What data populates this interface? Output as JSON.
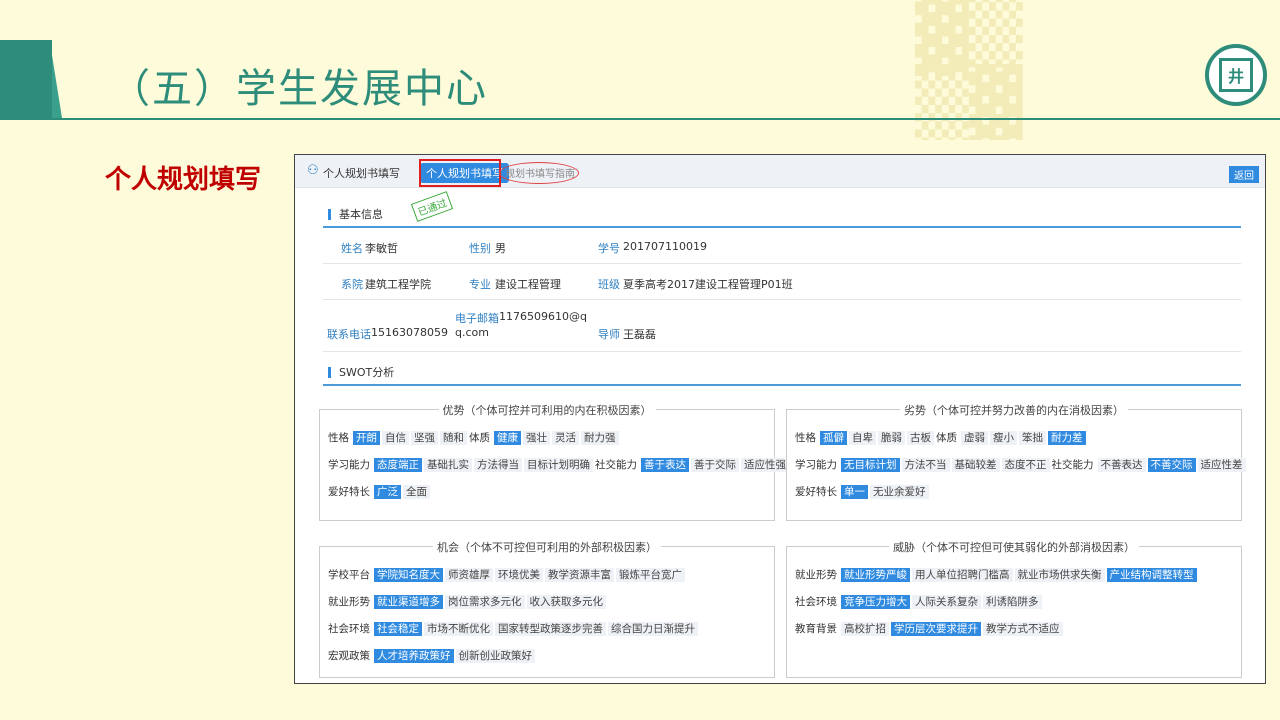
{
  "slide": {
    "title": "（五）学生发展中心",
    "side_label": "个人规划填写"
  },
  "topbar": {
    "title": "个人规划书填写",
    "active_tab": "个人规划书填写",
    "guide_link": "规划书填写指南",
    "back": "返回"
  },
  "basic": {
    "heading": "基本信息",
    "stamp": "已通过",
    "name_label": "姓名",
    "name": "李敏哲",
    "gender_label": "性别",
    "gender": "男",
    "id_label": "学号",
    "id": "201707110019",
    "dept_label": "系院",
    "dept": "建筑工程学院",
    "major_label": "专业",
    "major": "建设工程管理",
    "class_label": "班级",
    "class": "夏季高考2017建设工程管理P01班",
    "phone_label": "联系电话",
    "phone": "15163078059",
    "email_label": "电子邮箱",
    "email_1": "1176509610@q",
    "email_2": "q.com",
    "tutor_label": "导师",
    "tutor": "王磊磊"
  },
  "swot": {
    "heading": "SWOT分析",
    "boxes": [
      {
        "title": "优势（个体可控并可利用的内在积极因素）",
        "rows": [
          {
            "cat": "性格",
            "tags": [
              {
                "t": "开朗",
                "s": true
              },
              {
                "t": "自信",
                "s": false
              },
              {
                "t": "坚强",
                "s": false
              },
              {
                "t": "随和",
                "s": false
              },
              {
                "t": "体质",
                "s": false,
                "plain": true
              },
              {
                "t": "健康",
                "s": true
              },
              {
                "t": "强壮",
                "s": false
              },
              {
                "t": "灵活",
                "s": false
              },
              {
                "t": "耐力强",
                "s": false
              }
            ]
          },
          {
            "cat": "学习能力",
            "tags": [
              {
                "t": "态度端正",
                "s": true
              },
              {
                "t": "基础扎实",
                "s": false
              },
              {
                "t": "方法得当",
                "s": false
              },
              {
                "t": "目标计划明确",
                "s": false
              },
              {
                "t": "社交能力",
                "s": false,
                "plain": true
              },
              {
                "t": "善于表达",
                "s": true
              },
              {
                "t": "善于交际",
                "s": false
              },
              {
                "t": "适应性强",
                "s": false
              }
            ]
          },
          {
            "cat": "爱好特长",
            "tags": [
              {
                "t": "广泛",
                "s": true
              },
              {
                "t": "全面",
                "s": false
              }
            ]
          }
        ]
      },
      {
        "title": "劣势（个体可控并努力改善的内在消极因素）",
        "rows": [
          {
            "cat": "性格",
            "tags": [
              {
                "t": "孤僻",
                "s": true
              },
              {
                "t": "自卑",
                "s": false
              },
              {
                "t": "脆弱",
                "s": false
              },
              {
                "t": "古板",
                "s": false
              },
              {
                "t": "体质",
                "s": false,
                "plain": true
              },
              {
                "t": "虚弱",
                "s": false
              },
              {
                "t": "瘦小",
                "s": false
              },
              {
                "t": "笨拙",
                "s": false
              },
              {
                "t": "耐力差",
                "s": true
              }
            ]
          },
          {
            "cat": "学习能力",
            "tags": [
              {
                "t": "无目标计划",
                "s": true
              },
              {
                "t": "方法不当",
                "s": false
              },
              {
                "t": "基础较差",
                "s": false
              },
              {
                "t": "态度不正",
                "s": false
              },
              {
                "t": "社交能力",
                "s": false,
                "plain": true
              },
              {
                "t": "不善表达",
                "s": false
              },
              {
                "t": "不善交际",
                "s": true
              },
              {
                "t": "适应性差",
                "s": false
              }
            ]
          },
          {
            "cat": "爱好特长",
            "tags": [
              {
                "t": "单一",
                "s": true
              },
              {
                "t": "无业余爱好",
                "s": false
              }
            ]
          }
        ]
      },
      {
        "title": "机会（个体不可控但可利用的外部积极因素）",
        "rows": [
          {
            "cat": "学校平台",
            "tags": [
              {
                "t": "学院知名度大",
                "s": true
              },
              {
                "t": "师资雄厚",
                "s": false
              },
              {
                "t": "环境优美",
                "s": false
              },
              {
                "t": "教学资源丰富",
                "s": false
              },
              {
                "t": "锻炼平台宽广",
                "s": false
              }
            ]
          },
          {
            "cat": "就业形势",
            "tags": [
              {
                "t": "就业渠道增多",
                "s": true
              },
              {
                "t": "岗位需求多元化",
                "s": false
              },
              {
                "t": "收入获取多元化",
                "s": false
              }
            ]
          },
          {
            "cat": "社会环境",
            "tags": [
              {
                "t": "社会稳定",
                "s": true
              },
              {
                "t": "市场不断优化",
                "s": false
              },
              {
                "t": "国家转型政策逐步完善",
                "s": false
              },
              {
                "t": "综合国力日渐提升",
                "s": false
              }
            ]
          },
          {
            "cat": "宏观政策",
            "tags": [
              {
                "t": "人才培养政策好",
                "s": true
              },
              {
                "t": "创新创业政策好",
                "s": false
              }
            ]
          }
        ]
      },
      {
        "title": "威胁（个体不可控但可使其弱化的外部消极因素）",
        "rows": [
          {
            "cat": "就业形势",
            "tags": [
              {
                "t": "就业形势严峻",
                "s": true
              },
              {
                "t": "用人单位招聘门槛高",
                "s": false
              },
              {
                "t": "就业市场供求失衡",
                "s": false
              },
              {
                "t": "产业结构调整转型",
                "s": true
              }
            ]
          },
          {
            "cat": "社会环境",
            "tags": [
              {
                "t": "竞争压力增大",
                "s": true
              },
              {
                "t": "人际关系复杂",
                "s": false
              },
              {
                "t": "利诱陷阱多",
                "s": false
              }
            ]
          },
          {
            "cat": "教育背景",
            "tags": [
              {
                "t": "高校扩招",
                "s": false
              },
              {
                "t": "学历层次要求提升",
                "s": true
              },
              {
                "t": "教学方式不适应",
                "s": false
              }
            ]
          }
        ]
      }
    ]
  }
}
